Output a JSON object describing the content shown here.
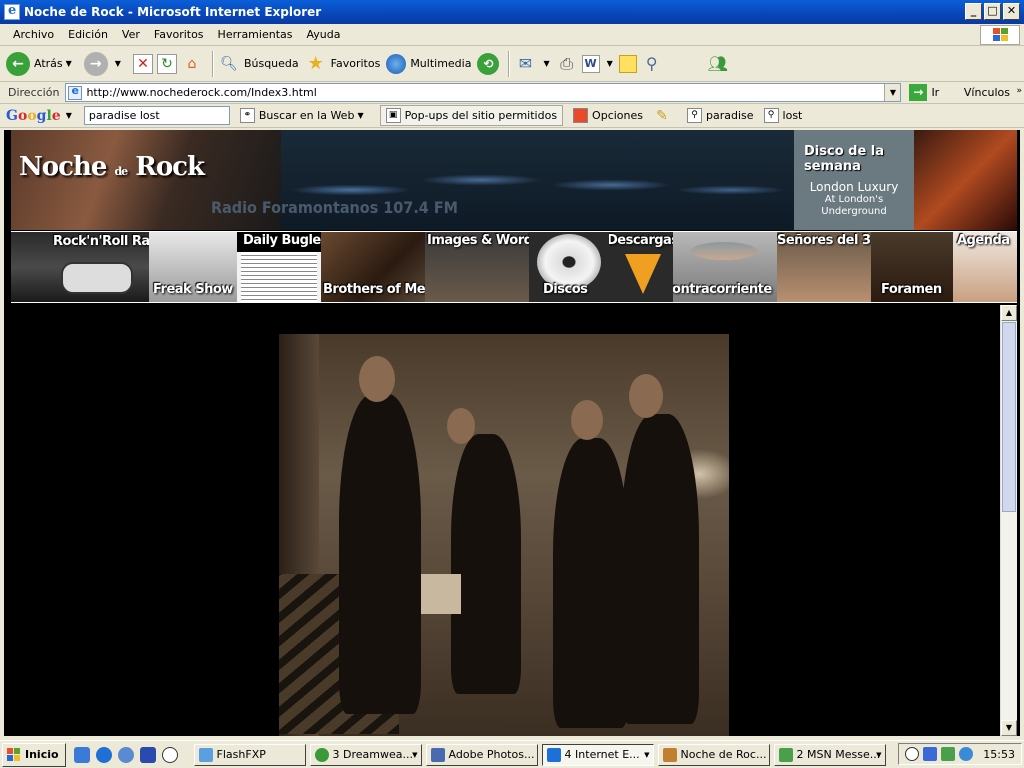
{
  "window": {
    "title": "Noche de Rock - Microsoft Internet Explorer",
    "minimize": "_",
    "maximize": "□",
    "close": "✕"
  },
  "menu": [
    "Archivo",
    "Edición",
    "Ver",
    "Favoritos",
    "Herramientas",
    "Ayuda"
  ],
  "toolbar": {
    "back": "Atrás",
    "search": "Búsqueda",
    "favorites": "Favoritos",
    "multimedia": "Multimedia"
  },
  "address": {
    "label": "Dirección",
    "url": "http://www.nochederock.com/Index3.html",
    "go": "Ir",
    "links": "Vínculos"
  },
  "google": {
    "logo": "Google",
    "query": "paradise lost",
    "search_web": "Buscar en la Web",
    "popups": "Pop-ups del sitio permitidos",
    "options": "Opciones",
    "term1": "paradise",
    "term2": "lost"
  },
  "site": {
    "logo_main": "Noche",
    "logo_de": "de",
    "logo_rock": "Rock",
    "radio": "Radio Foramontanos 107.4 FM",
    "disco_title": "Disco de la semana",
    "disco_album": "London Luxury",
    "disco_sub1": "At London's",
    "disco_sub2": "Underground",
    "nav": [
      {
        "label": "Rock'n'Roll Radio"
      },
      {
        "label": "Freak Show"
      },
      {
        "label": "Daily Bugle"
      },
      {
        "label": "Brothers of Metal"
      },
      {
        "label": "Images & Words"
      },
      {
        "label": "Discos"
      },
      {
        "label": "Descargas"
      },
      {
        "label": "Contracorriente"
      },
      {
        "label": "Señores del 3"
      },
      {
        "label": "Foramen"
      },
      {
        "label": "Agenda"
      }
    ]
  },
  "taskbar": {
    "start": "Inicio",
    "tasks": [
      {
        "label": "FlashFXP",
        "color": "#5aa0e0",
        "arrow": false,
        "active": false
      },
      {
        "label": "3 Dreamwea...",
        "color": "#3a9a3a",
        "arrow": true,
        "active": false
      },
      {
        "label": "Adobe Photos...",
        "color": "#4a6ab0",
        "arrow": false,
        "active": false
      },
      {
        "label": "4 Internet E...",
        "color": "#1e6fd6",
        "arrow": true,
        "active": true
      },
      {
        "label": "Noche de Roc...",
        "color": "#c08030",
        "arrow": false,
        "active": false
      },
      {
        "label": "2 MSN Messe...",
        "color": "#4aa04a",
        "arrow": true,
        "active": false
      }
    ],
    "clock": "15:53"
  }
}
